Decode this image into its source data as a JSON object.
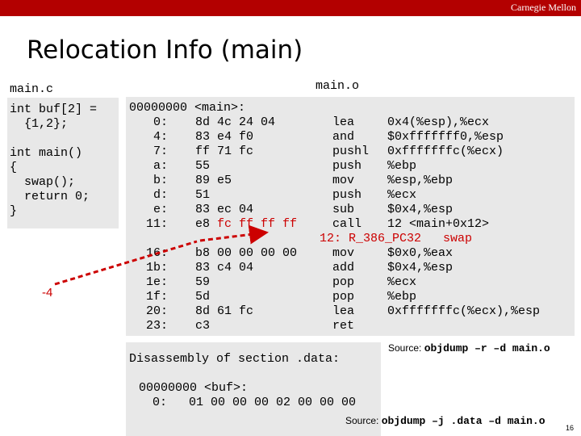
{
  "header": {
    "brand": "Carnegie Mellon"
  },
  "title": "Relocation Info (main)",
  "source": {
    "filename": "main.c",
    "lines": [
      "int buf[2] =",
      "  {1,2};",
      "",
      "int main()",
      "{",
      "  swap();",
      "  return 0;",
      "}"
    ]
  },
  "object": {
    "filename": "main.o",
    "label_line": "00000000 <main>:",
    "addrs": [
      "0:",
      "4:",
      "7:",
      "a:",
      "b:",
      "d:",
      "e:",
      "11:",
      "",
      "16:",
      "1b:",
      "1e:",
      "1f:",
      "20:",
      "23:"
    ],
    "bytes": [
      "8d 4c 24 04",
      "83 e4 f0",
      "ff 71 fc",
      "55",
      "89 e5",
      "51",
      "83 ec 04",
      "e8 ",
      "",
      "b8 00 00 00 00",
      "83 c4 04",
      "59",
      "5d",
      "8d 61 fc",
      "c3"
    ],
    "reloc_bytes": "fc ff ff ff",
    "ops": [
      "lea",
      "and",
      "pushl",
      "push",
      "mov",
      "push",
      "sub",
      "call",
      "",
      "mov",
      "add",
      "pop",
      "pop",
      "lea",
      "ret"
    ],
    "args": [
      "0x4(%esp),%ecx",
      "$0xfffffff0,%esp",
      "0xfffffffc(%ecx)",
      "%ebp",
      "%esp,%ebp",
      "%ecx",
      "$0x4,%esp",
      "12 <main+0x12>",
      "",
      "$0x0,%eax",
      "$0x4,%esp",
      "%ecx",
      "%ebp",
      "0xfffffffc(%ecx),%esp",
      ""
    ],
    "relocation": "12: R_386_PC32   swap"
  },
  "annotation": {
    "offset": "-4"
  },
  "data_section": {
    "heading": "Disassembly of section .data:",
    "label_line": "00000000 <buf>:",
    "value_line": "0:   01 00 00 00 02 00 00 00"
  },
  "sources": {
    "top": {
      "prefix": "Source: ",
      "cmd": "objdump –r –d main.o"
    },
    "bottom": {
      "prefix": "Source: ",
      "cmd": "objdump –j .data –d main.o"
    }
  },
  "page_number": "16",
  "colors": {
    "banner": "#b30000",
    "highlight": "#cc0000",
    "box": "#e8e8e8"
  }
}
